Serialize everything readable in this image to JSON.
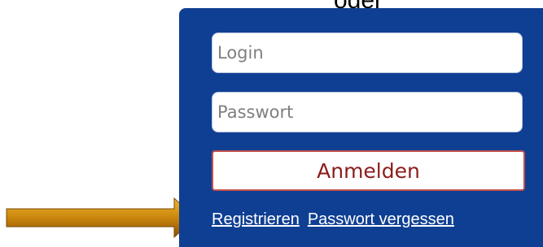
{
  "caption": "oder",
  "form": {
    "login_placeholder": "Login",
    "password_placeholder": "Passwort",
    "submit_label": "Anmelden"
  },
  "links": {
    "register": "Registrieren",
    "forgot_password": "Passwort vergessen"
  },
  "colors": {
    "panel": "#0f3f93",
    "button_border": "#c0504d",
    "arrow": "#c8860a"
  }
}
